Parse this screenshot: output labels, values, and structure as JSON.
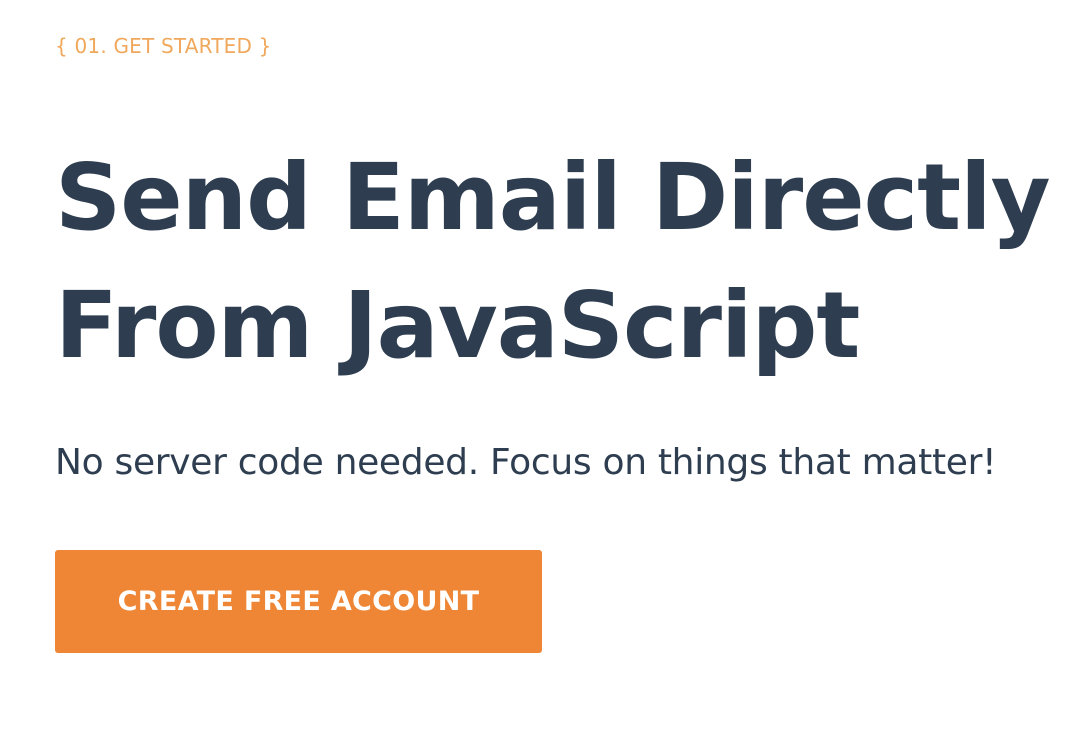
{
  "hero": {
    "eyebrow": "{ 01. GET STARTED }",
    "headline_line1": "Send Email Directly",
    "headline_line2": "From JavaScript",
    "subheadline": "No server code needed. Focus on things that matter!",
    "cta_label": "CREATE FREE ACCOUNT"
  },
  "colors": {
    "accent": "#ee8636",
    "eyebrow": "#f0a85c",
    "text": "#2e3e50",
    "background": "#ffffff"
  }
}
